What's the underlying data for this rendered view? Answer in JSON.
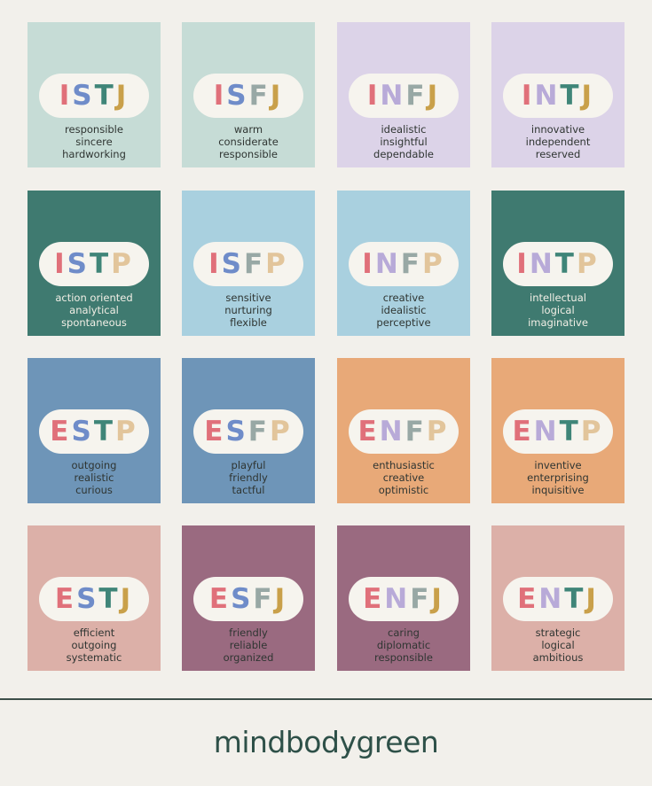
{
  "colors": {
    "letters": {
      "I": "#e0707a",
      "E": "#e0707a",
      "S": "#6f8cc9",
      "N": "#b8aad8",
      "T": "#3f8578",
      "F": "#98a8a5",
      "J": "#c9a04a",
      "P": "#e2c59b"
    }
  },
  "cards": [
    {
      "type": "ISTJ",
      "bg": "#c6dcd6",
      "traits": [
        "responsible",
        "sincere",
        "hardworking"
      ],
      "text_color": "#2f3532"
    },
    {
      "type": "ISFJ",
      "bg": "#c6dcd6",
      "traits": [
        "warm",
        "considerate",
        "responsible"
      ],
      "text_color": "#2f3532"
    },
    {
      "type": "INFJ",
      "bg": "#dcd3e8",
      "traits": [
        "idealistic",
        "insightful",
        "dependable"
      ],
      "text_color": "#2f3532"
    },
    {
      "type": "INTJ",
      "bg": "#dcd3e8",
      "traits": [
        "innovative",
        "independent",
        "reserved"
      ],
      "text_color": "#2f3532"
    },
    {
      "type": "ISTP",
      "bg": "#3f7a70",
      "traits": [
        "action oriented",
        "analytical",
        "spontaneous"
      ],
      "text_color": "#f2efe6"
    },
    {
      "type": "ISFP",
      "bg": "#a9d0df",
      "traits": [
        "sensitive",
        "nurturing",
        "flexible"
      ],
      "text_color": "#2f3532"
    },
    {
      "type": "INFP",
      "bg": "#a9d0df",
      "traits": [
        "creative",
        "idealistic",
        "perceptive"
      ],
      "text_color": "#2f3532"
    },
    {
      "type": "INTP",
      "bg": "#3f7a70",
      "traits": [
        "intellectual",
        "logical",
        "imaginative"
      ],
      "text_color": "#f2efe6"
    },
    {
      "type": "ESTP",
      "bg": "#6e95b8",
      "traits": [
        "outgoing",
        "realistic",
        "curious"
      ],
      "text_color": "#2f3532"
    },
    {
      "type": "ESFP",
      "bg": "#6e95b8",
      "traits": [
        "playful",
        "friendly",
        "tactful"
      ],
      "text_color": "#2f3532"
    },
    {
      "type": "ENFP",
      "bg": "#e8a978",
      "traits": [
        "enthusiastic",
        "creative",
        "optimistic"
      ],
      "text_color": "#2f3532"
    },
    {
      "type": "ENTP",
      "bg": "#e8a978",
      "traits": [
        "inventive",
        "enterprising",
        "inquisitive"
      ],
      "text_color": "#2f3532"
    },
    {
      "type": "ESTJ",
      "bg": "#dcb0a8",
      "traits": [
        "efficient",
        "outgoing",
        "systematic"
      ],
      "text_color": "#2f3532"
    },
    {
      "type": "ESFJ",
      "bg": "#9a6a80",
      "traits": [
        "friendly",
        "reliable",
        "organized"
      ],
      "text_color": "#2f3532"
    },
    {
      "type": "ENFJ",
      "bg": "#9a6a80",
      "traits": [
        "caring",
        "diplomatic",
        "responsible"
      ],
      "text_color": "#2f3532"
    },
    {
      "type": "ENTJ",
      "bg": "#dcb0a8",
      "traits": [
        "strategic",
        "logical",
        "ambitious"
      ],
      "text_color": "#2f3532"
    }
  ],
  "footer": {
    "brand": "mindbodygreen"
  }
}
